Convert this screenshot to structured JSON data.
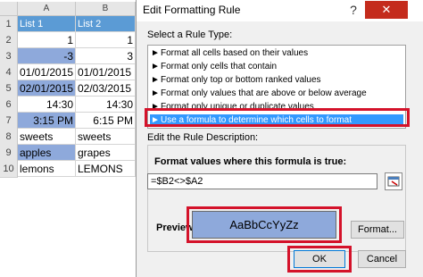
{
  "sheet": {
    "columns": [
      "A",
      "B"
    ],
    "rows": [
      {
        "num": "1",
        "a": "List 1",
        "b": "List 2",
        "header": true
      },
      {
        "num": "2",
        "a": "1",
        "b": "1",
        "align": "right"
      },
      {
        "num": "3",
        "a": "-3",
        "b": "3",
        "align": "right",
        "hl": true
      },
      {
        "num": "4",
        "a": "01/01/2015",
        "b": "01/01/2015",
        "align": "left"
      },
      {
        "num": "5",
        "a": "02/01/2015",
        "b": "02/03/2015",
        "align": "left",
        "hl": true
      },
      {
        "num": "6",
        "a": "14:30",
        "b": "14:30",
        "align": "right"
      },
      {
        "num": "7",
        "a": "3:15 PM",
        "b": "6:15 PM",
        "align": "right",
        "hl": true
      },
      {
        "num": "8",
        "a": "sweets",
        "b": "sweets",
        "align": "left"
      },
      {
        "num": "9",
        "a": "apples",
        "b": "grapes",
        "align": "left",
        "hl": true
      },
      {
        "num": "10",
        "a": "lemons",
        "b": "LEMONS",
        "align": "left"
      }
    ],
    "highlight_color": "#8ea9db",
    "header_color": "#5b9bd5"
  },
  "dialog": {
    "title": "Edit Formatting Rule",
    "help_label": "?",
    "close_label": "✕",
    "select_rule_type_label": "Select a Rule Type:",
    "rule_types": [
      "Format all cells based on their values",
      "Format only cells that contain",
      "Format only top or bottom ranked values",
      "Format only values that are above or below average",
      "Format only unique or duplicate values",
      "Use a formula to determine which cells to format"
    ],
    "selected_rule_index": 5,
    "edit_description_label": "Edit the Rule Description:",
    "formula_label": "Format values where this formula is true:",
    "formula_value": "=$B2<>$A2",
    "preview_label": "Preview:",
    "preview_text": "AaBbCcYyZz",
    "format_button": "Format...",
    "ok_button": "OK",
    "cancel_button": "Cancel",
    "accent_color": "#d4122a",
    "selection_color": "#3399ff"
  }
}
